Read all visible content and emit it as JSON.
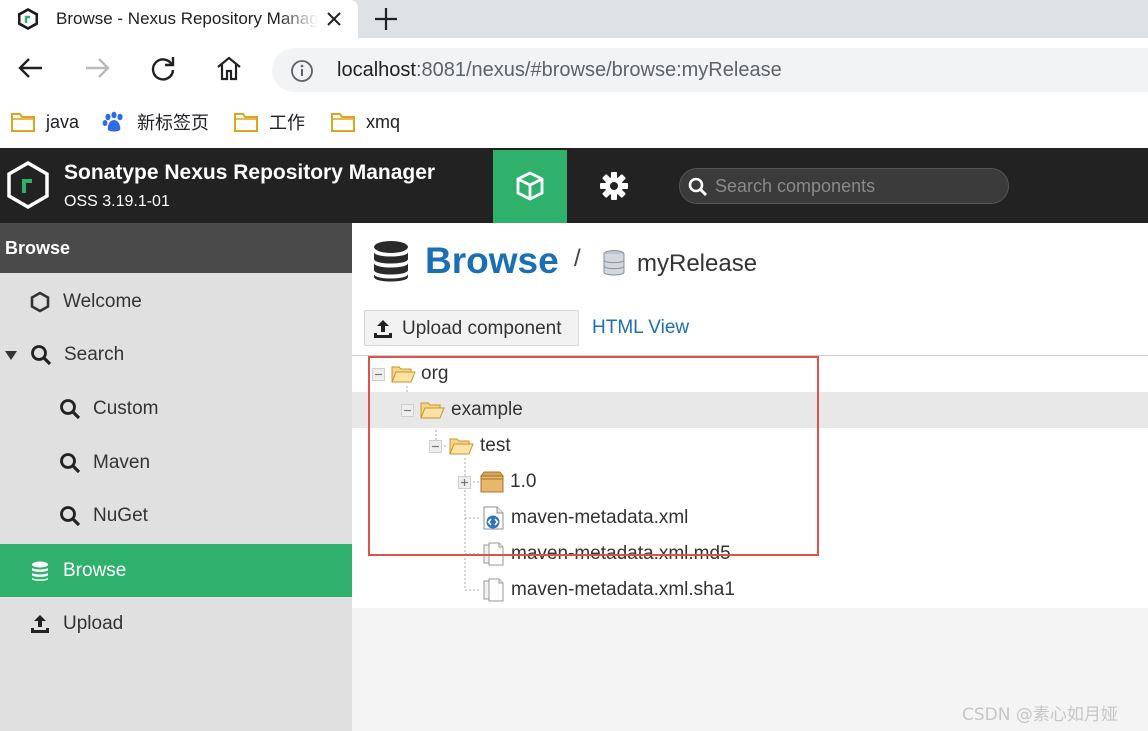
{
  "browser": {
    "tab_title": "Browse - Nexus Repository Manager",
    "url_host": "localhost",
    "url_rest": ":8081/nexus/#browse/browse:myRelease",
    "bookmarks": [
      {
        "label": "java",
        "icon": "folder-icon"
      },
      {
        "label": "新标签页",
        "icon": "baidu-paw-icon"
      },
      {
        "label": "工作",
        "icon": "folder-icon"
      },
      {
        "label": "xmq",
        "icon": "folder-icon"
      }
    ]
  },
  "header": {
    "title": "Sonatype Nexus Repository Manager",
    "version": "OSS 3.19.1-01",
    "search_placeholder": "Search components"
  },
  "sidebar": {
    "heading": "Browse",
    "items": [
      {
        "label": "Welcome",
        "icon": "hexagon-icon"
      },
      {
        "label": "Search",
        "icon": "search-icon"
      },
      {
        "label": "Custom",
        "icon": "search-icon"
      },
      {
        "label": "Maven",
        "icon": "search-icon"
      },
      {
        "label": "NuGet",
        "icon": "search-icon"
      },
      {
        "label": "Browse",
        "icon": "database-icon",
        "active": true
      },
      {
        "label": "Upload",
        "icon": "upload-icon"
      }
    ]
  },
  "main": {
    "breadcrumb_title": "Browse",
    "breadcrumb_sep": "/",
    "repo_name": "myRelease",
    "upload_label": "Upload component",
    "html_view_label": "HTML View",
    "tree": [
      {
        "label": "org",
        "icon": "folder-open-icon"
      },
      {
        "label": "example",
        "icon": "folder-open-icon"
      },
      {
        "label": "test",
        "icon": "folder-open-icon"
      },
      {
        "label": "1.0",
        "icon": "package-icon"
      },
      {
        "label": "maven-metadata.xml",
        "icon": "xml-file-icon"
      },
      {
        "label": "maven-metadata.xml.md5",
        "icon": "file-icon"
      },
      {
        "label": "maven-metadata.xml.sha1",
        "icon": "file-icon"
      }
    ]
  },
  "watermark": "CSDN @素心如月娅",
  "colors": {
    "nexus_green": "#2fb06b",
    "header_dark": "#222222",
    "link_blue": "#1c6fb5",
    "highlight_red": "#d9534f"
  }
}
